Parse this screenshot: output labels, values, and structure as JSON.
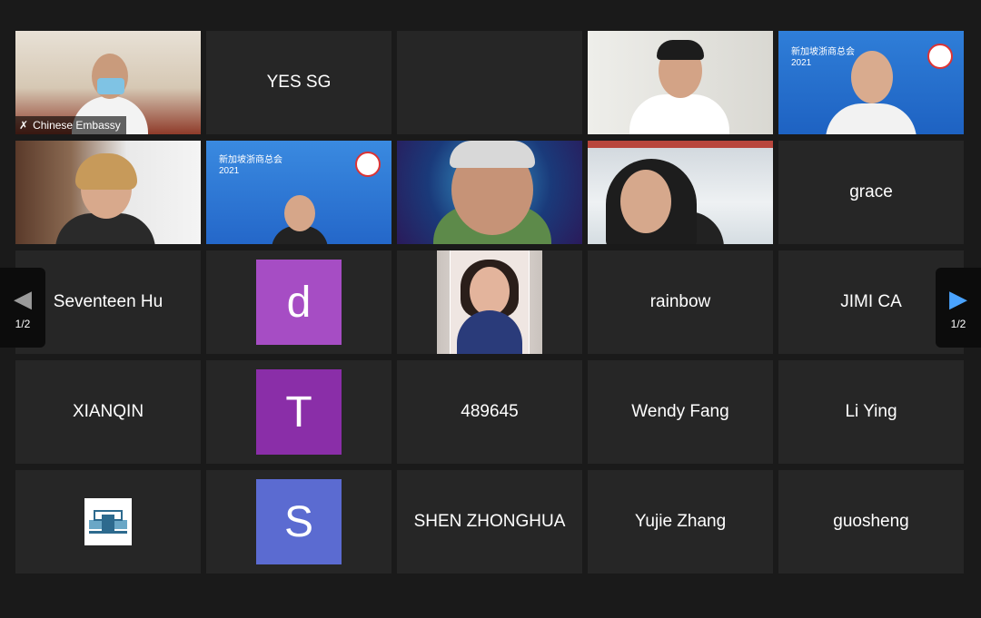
{
  "pager": {
    "page": "1/2"
  },
  "colors": {
    "active_border": "#c9dc7a",
    "tile_bg": "#262626",
    "nav_arrow_right": "#4aa3ff"
  },
  "tiles": [
    {
      "type": "video",
      "label": "Chinese Embassy",
      "active": true,
      "muted_icon": "mic-muted-icon"
    },
    {
      "type": "name",
      "label": "YES SG"
    },
    {
      "type": "empty"
    },
    {
      "type": "video"
    },
    {
      "type": "video",
      "banner": "新加坡浙商总会",
      "year": "2021"
    },
    {
      "type": "video"
    },
    {
      "type": "video",
      "banner": "新加坡浙商总会",
      "year": "2021"
    },
    {
      "type": "video"
    },
    {
      "type": "video"
    },
    {
      "type": "name",
      "label": "grace"
    },
    {
      "type": "name",
      "label": "Seventeen Hu"
    },
    {
      "type": "avatar",
      "letter": "d",
      "color": "#a64dc4"
    },
    {
      "type": "photo"
    },
    {
      "type": "name",
      "label": "rainbow"
    },
    {
      "type": "name",
      "label": "JIMI CA"
    },
    {
      "type": "name",
      "label": "XIANQIN"
    },
    {
      "type": "avatar",
      "letter": "T",
      "color": "#8a2ea8"
    },
    {
      "type": "name",
      "label": "489645"
    },
    {
      "type": "name",
      "label": "Wendy Fang"
    },
    {
      "type": "name",
      "label": "Li Ying"
    },
    {
      "type": "logo"
    },
    {
      "type": "avatar",
      "letter": "S",
      "color": "#5b6bd1"
    },
    {
      "type": "name",
      "label": "SHEN ZHONGHUA"
    },
    {
      "type": "name",
      "label": "Yujie Zhang"
    },
    {
      "type": "name",
      "label": "guosheng"
    }
  ]
}
